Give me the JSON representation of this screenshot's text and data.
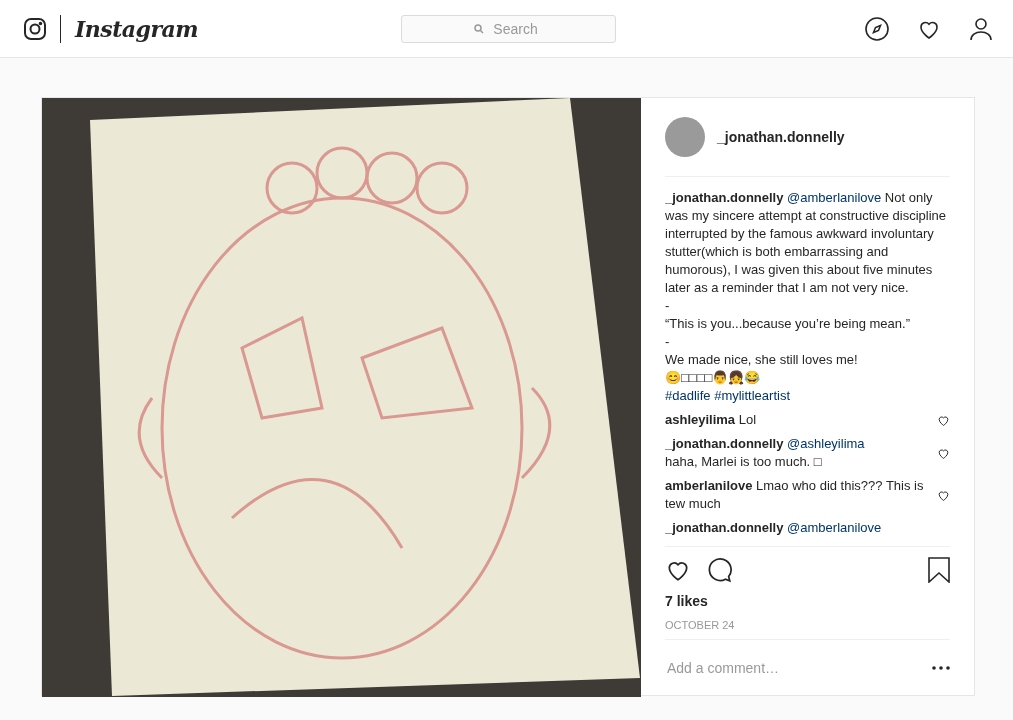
{
  "header": {
    "logo": "Instagram",
    "search": {
      "placeholder": "Search"
    }
  },
  "post": {
    "author": "_jonathan.donnelly",
    "caption": {
      "user": "_jonathan.donnelly",
      "mention": "@amberlanilove",
      "text": "Not only was my sincere attempt at constructive discipline interrupted by the famous awkward involuntary stutter(which is both embarrassing and humorous), I was given this about five minutes later as a reminder that I am not very nice.\n-\n“This is you...because you’re being mean.”\n-\nWe made nice, she still loves me!\n😊□□□□👨👧😂",
      "hashtags": [
        "#dadlife",
        "#mylittleartist"
      ]
    },
    "comments": [
      {
        "user": "ashleyilima",
        "text": "Lol"
      },
      {
        "user": "_jonathan.donnelly",
        "mention": "@ashleyilima",
        "text": "haha, Marlei is too much. □"
      },
      {
        "user": "amberlanilove",
        "text": "Lmao who did this??? This is tew much"
      },
      {
        "user": "_jonathan.donnelly",
        "mention": "@amberlanilove"
      }
    ],
    "likes": "7 likes",
    "date": "OCTOBER 24",
    "comment_placeholder": "Add a comment…"
  }
}
